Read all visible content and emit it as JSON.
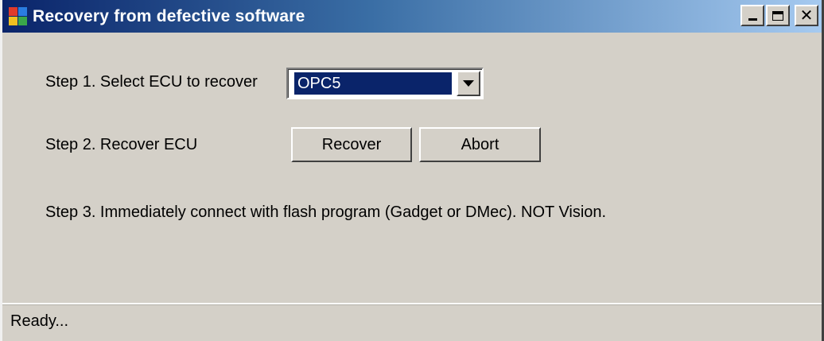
{
  "window": {
    "title": "Recovery from defective software",
    "icon": "app-window-icon",
    "controls": {
      "minimize": "minimize-icon",
      "maximize": "maximize-icon",
      "close": "close-icon"
    }
  },
  "step1": {
    "label": "Step 1. Select ECU to recover",
    "selected": "OPC5"
  },
  "step2": {
    "label": "Step 2. Recover ECU",
    "recover_label": "Recover",
    "abort_label": "Abort"
  },
  "step3": {
    "label": "Step 3.  Immediately connect with flash program (Gadget or DMec). NOT Vision."
  },
  "status": {
    "text": "Ready..."
  },
  "colors": {
    "face": "#d4d0c8",
    "title_start": "#0a246a",
    "title_end": "#a6caf0",
    "selection": "#0a246a"
  }
}
